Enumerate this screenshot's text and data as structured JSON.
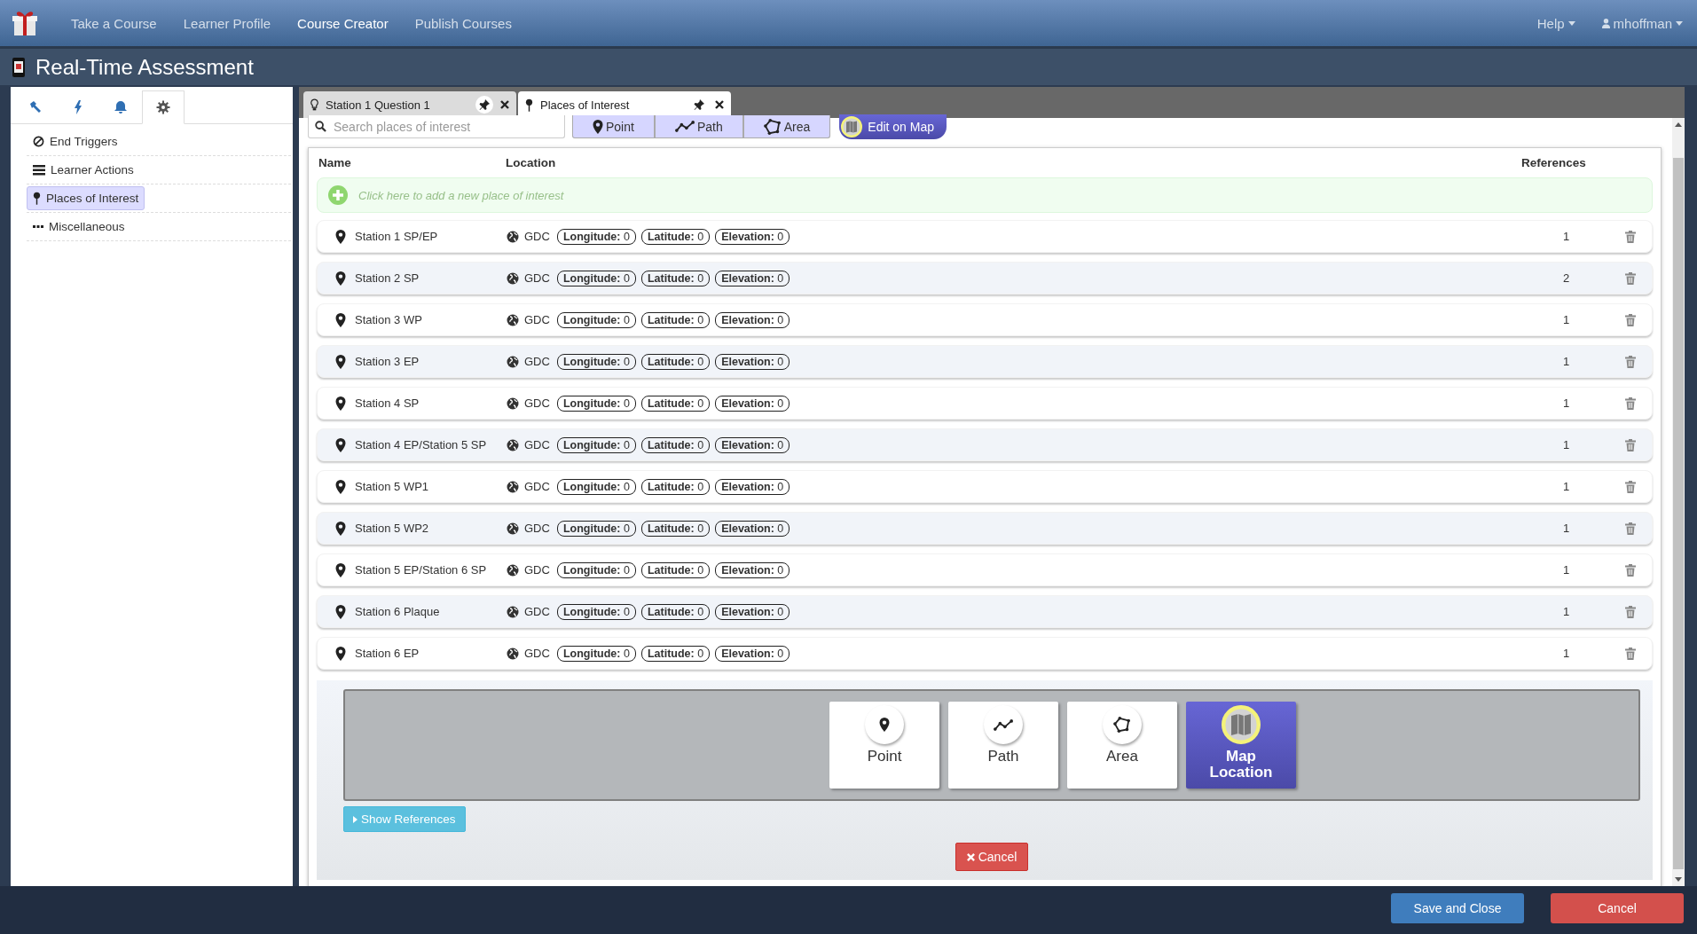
{
  "nav": {
    "items": [
      {
        "label": "Take a Course",
        "selected": false
      },
      {
        "label": "Learner Profile",
        "selected": false
      },
      {
        "label": "Course Creator",
        "selected": true
      },
      {
        "label": "Publish Courses",
        "selected": false
      }
    ],
    "help": "Help",
    "user": "mhoffman"
  },
  "title": "Real-Time Assessment",
  "sidebar": {
    "tabs": [
      {
        "selected": false
      },
      {
        "selected": false
      },
      {
        "selected": false
      },
      {
        "selected": true
      }
    ],
    "items": [
      {
        "label": "End Triggers",
        "selected": false
      },
      {
        "label": "Learner Actions",
        "selected": false
      },
      {
        "label": "Places of Interest",
        "selected": true
      },
      {
        "label": "Miscellaneous",
        "selected": false
      }
    ]
  },
  "editor_tabs": [
    {
      "label": "Station 1 Question 1",
      "selected": false
    },
    {
      "label": "Places of Interest",
      "selected": true
    }
  ],
  "toolbar": {
    "search_placeholder": "Search places of interest",
    "shape_buttons": [
      "Point",
      "Path",
      "Area"
    ],
    "edit_on_map": "Edit on Map"
  },
  "table": {
    "columns": [
      "Name",
      "Location",
      "References"
    ],
    "add_prompt": "Click here to add a new place of interest",
    "rows": [
      {
        "name": "Station 1 SP/EP",
        "system": "GDC",
        "coords": [
          "**Longitude:** 0",
          "**Latitude:** 0",
          "**Elevation:** 0"
        ],
        "references": "1"
      },
      {
        "name": "Station 2 SP",
        "system": "GDC",
        "coords": [
          "**Longitude:** 0",
          "**Latitude:** 0",
          "**Elevation:** 0"
        ],
        "references": "2"
      },
      {
        "name": "Station 3 WP",
        "system": "GDC",
        "coords": [
          "**Longitude:** 0",
          "**Latitude:** 0",
          "**Elevation:** 0"
        ],
        "references": "1"
      },
      {
        "name": "Station 3 EP",
        "system": "GDC",
        "coords": [
          "**Longitude:** 0",
          "**Latitude:** 0",
          "**Elevation:** 0"
        ],
        "references": "1"
      },
      {
        "name": "Station 4 SP",
        "system": "GDC",
        "coords": [
          "**Longitude:** 0",
          "**Latitude:** 0",
          "**Elevation:** 0"
        ],
        "references": "1"
      },
      {
        "name": "Station 4 EP/Station 5 SP",
        "system": "GDC",
        "coords": [
          "**Longitude:** 0",
          "**Latitude:** 0",
          "**Elevation:** 0"
        ],
        "references": "1"
      },
      {
        "name": "Station 5 WP1",
        "system": "GDC",
        "coords": [
          "**Longitude:** 0",
          "**Latitude:** 0",
          "**Elevation:** 0"
        ],
        "references": "1"
      },
      {
        "name": "Station 5 WP2",
        "system": "GDC",
        "coords": [
          "**Longitude:** 0",
          "**Latitude:** 0",
          "**Elevation:** 0"
        ],
        "references": "1"
      },
      {
        "name": "Station 5 EP/Station 6 SP",
        "system": "GDC",
        "coords": [
          "**Longitude:** 0",
          "**Latitude:** 0",
          "**Elevation:** 0"
        ],
        "references": "1"
      },
      {
        "name": "Station 6 Plaque",
        "system": "GDC",
        "coords": [
          "**Longitude:** 0",
          "**Latitude:** 0",
          "**Elevation:** 0"
        ],
        "references": "1"
      },
      {
        "name": "Station 6 EP",
        "system": "GDC",
        "coords": [
          "**Longitude:** 0",
          "**Latitude:** 0",
          "**Elevation:** 0"
        ],
        "references": "1"
      }
    ]
  },
  "type_picker": [
    {
      "label": "Point",
      "selected": false
    },
    {
      "label": "Path",
      "selected": false
    },
    {
      "label": "Area",
      "selected": false
    },
    {
      "label": "Map Location",
      "selected": true
    }
  ],
  "show_references": "Show References",
  "inline_cancel": "Cancel",
  "footer": {
    "save": "Save and Close",
    "cancel": "Cancel"
  }
}
